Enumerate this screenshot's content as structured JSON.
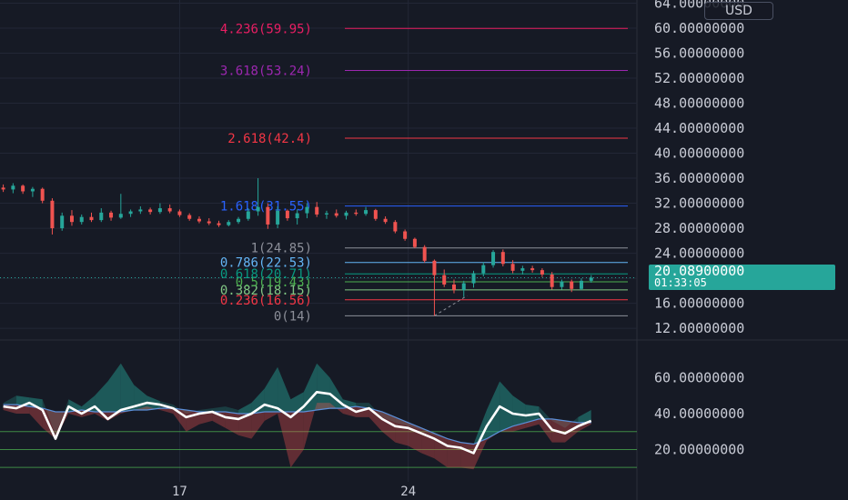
{
  "currency_label": "USD",
  "price_label": {
    "price": "20.08900000",
    "countdown": "01:33:05"
  },
  "x_axis": {
    "ticks": [
      {
        "label": "17",
        "day": 17
      },
      {
        "label": "24",
        "day": 24
      }
    ]
  },
  "colors": {
    "background": "#161a25",
    "up": "#26a69a",
    "down": "#ef5350",
    "grid": "#222736",
    "axis_text": "#c9ccd6"
  },
  "chart_data": [
    {
      "type": "candlestick",
      "y_scale": "linear",
      "ylim": [
        11,
        64.5
      ],
      "y_ticks": [
        {
          "value": 12,
          "label": "12.00000000"
        },
        {
          "value": 16,
          "label": "16.00000000"
        },
        {
          "value": 20,
          "label": "20.00000000"
        },
        {
          "value": 24,
          "label": "24.00000000"
        },
        {
          "value": 28,
          "label": "28.00000000"
        },
        {
          "value": 32,
          "label": "32.00000000"
        },
        {
          "value": 36,
          "label": "36.00000000"
        },
        {
          "value": 40,
          "label": "40.00000000"
        },
        {
          "value": 44,
          "label": "44.00000000"
        },
        {
          "value": 48,
          "label": "48.00000000"
        },
        {
          "value": 52,
          "label": "52.00000000"
        },
        {
          "value": 56,
          "label": "56.00000000"
        },
        {
          "value": 60,
          "label": "60.00000000"
        },
        {
          "value": 64,
          "label": "64.00000000"
        }
      ],
      "fib_levels": [
        {
          "ratio": "0",
          "value": 14,
          "label": "0(14)",
          "color": "#8c8f99"
        },
        {
          "ratio": "0.236",
          "value": 16.56,
          "label": "0.236(16.56)",
          "color": "#f23645"
        },
        {
          "ratio": "0.382",
          "value": 18.15,
          "label": "0.382(18.15)",
          "color": "#81c784"
        },
        {
          "ratio": "0.5",
          "value": 19.43,
          "label": "0.5(19.43)",
          "color": "#4caf50"
        },
        {
          "ratio": "0.618",
          "value": 20.71,
          "label": "0.618(20.71)",
          "color": "#089981"
        },
        {
          "ratio": "0.786",
          "value": 22.53,
          "label": "0.786(22.53)",
          "color": "#64b5f6"
        },
        {
          "ratio": "1",
          "value": 24.85,
          "label": "1(24.85)",
          "color": "#8c8f99"
        },
        {
          "ratio": "1.618",
          "value": 31.55,
          "label": "1.618(31.55)",
          "color": "#2962ff"
        },
        {
          "ratio": "2.618",
          "value": 42.4,
          "label": "2.618(42.4)",
          "color": "#f23645"
        },
        {
          "ratio": "3.618",
          "value": 53.24,
          "label": "3.618(53.24)",
          "color": "#9c27b0"
        },
        {
          "ratio": "4.236",
          "value": 59.95,
          "label": "4.236(59.95)",
          "color": "#e91e63"
        }
      ],
      "candles": [
        {
          "d": 11.6,
          "o": 34.5,
          "h": 35.0,
          "l": 33.8,
          "c": 34.2
        },
        {
          "d": 11.9,
          "o": 34.2,
          "h": 35.2,
          "l": 33.6,
          "c": 34.8
        },
        {
          "d": 12.2,
          "o": 34.8,
          "h": 35.0,
          "l": 33.5,
          "c": 33.9
        },
        {
          "d": 12.5,
          "o": 33.9,
          "h": 34.6,
          "l": 33.0,
          "c": 34.3
        },
        {
          "d": 12.8,
          "o": 34.3,
          "h": 34.5,
          "l": 32.0,
          "c": 32.4
        },
        {
          "d": 13.1,
          "o": 32.4,
          "h": 32.8,
          "l": 27.0,
          "c": 28.0
        },
        {
          "d": 13.4,
          "o": 28.0,
          "h": 30.5,
          "l": 27.6,
          "c": 30.0
        },
        {
          "d": 13.7,
          "o": 30.0,
          "h": 30.9,
          "l": 28.4,
          "c": 29.0
        },
        {
          "d": 14.0,
          "o": 29.0,
          "h": 30.2,
          "l": 28.6,
          "c": 29.8
        },
        {
          "d": 14.3,
          "o": 29.8,
          "h": 30.5,
          "l": 29.0,
          "c": 29.3
        },
        {
          "d": 14.6,
          "o": 29.3,
          "h": 31.2,
          "l": 29.0,
          "c": 30.5
        },
        {
          "d": 14.9,
          "o": 30.5,
          "h": 30.8,
          "l": 29.2,
          "c": 29.7
        },
        {
          "d": 15.2,
          "o": 29.7,
          "h": 33.5,
          "l": 29.5,
          "c": 30.3
        },
        {
          "d": 15.5,
          "o": 30.3,
          "h": 31.0,
          "l": 29.8,
          "c": 30.7
        },
        {
          "d": 15.8,
          "o": 30.7,
          "h": 31.5,
          "l": 30.3,
          "c": 31.0
        },
        {
          "d": 16.1,
          "o": 31.0,
          "h": 31.3,
          "l": 30.2,
          "c": 30.6
        },
        {
          "d": 16.4,
          "o": 30.6,
          "h": 32.0,
          "l": 30.3,
          "c": 31.2
        },
        {
          "d": 16.7,
          "o": 31.2,
          "h": 31.8,
          "l": 30.4,
          "c": 30.7
        },
        {
          "d": 17.0,
          "o": 30.7,
          "h": 31.0,
          "l": 29.8,
          "c": 30.1
        },
        {
          "d": 17.3,
          "o": 30.1,
          "h": 30.4,
          "l": 29.2,
          "c": 29.5
        },
        {
          "d": 17.6,
          "o": 29.5,
          "h": 29.9,
          "l": 28.8,
          "c": 29.1
        },
        {
          "d": 17.9,
          "o": 29.1,
          "h": 29.6,
          "l": 28.5,
          "c": 28.8
        },
        {
          "d": 18.2,
          "o": 28.8,
          "h": 29.2,
          "l": 28.2,
          "c": 28.5
        },
        {
          "d": 18.5,
          "o": 28.5,
          "h": 29.3,
          "l": 28.3,
          "c": 29.0
        },
        {
          "d": 18.8,
          "o": 29.0,
          "h": 29.8,
          "l": 28.7,
          "c": 29.5
        },
        {
          "d": 19.1,
          "o": 29.5,
          "h": 31.2,
          "l": 29.2,
          "c": 30.7
        },
        {
          "d": 19.4,
          "o": 30.7,
          "h": 36.0,
          "l": 30.0,
          "c": 31.4
        },
        {
          "d": 19.7,
          "o": 31.4,
          "h": 32.0,
          "l": 27.9,
          "c": 28.6
        },
        {
          "d": 20.0,
          "o": 28.6,
          "h": 31.5,
          "l": 28.0,
          "c": 30.8
        },
        {
          "d": 20.3,
          "o": 30.8,
          "h": 31.0,
          "l": 29.2,
          "c": 29.6
        },
        {
          "d": 20.6,
          "o": 29.6,
          "h": 31.0,
          "l": 28.6,
          "c": 30.4
        },
        {
          "d": 20.9,
          "o": 30.4,
          "h": 32.0,
          "l": 29.6,
          "c": 31.4
        },
        {
          "d": 21.2,
          "o": 31.4,
          "h": 32.2,
          "l": 29.8,
          "c": 30.2
        },
        {
          "d": 21.5,
          "o": 30.2,
          "h": 30.8,
          "l": 29.5,
          "c": 30.4
        },
        {
          "d": 21.8,
          "o": 30.4,
          "h": 31.0,
          "l": 29.7,
          "c": 30.0
        },
        {
          "d": 22.1,
          "o": 30.0,
          "h": 30.8,
          "l": 29.4,
          "c": 30.5
        },
        {
          "d": 22.4,
          "o": 30.5,
          "h": 31.0,
          "l": 30.0,
          "c": 30.3
        },
        {
          "d": 22.7,
          "o": 30.3,
          "h": 31.4,
          "l": 30.0,
          "c": 30.9
        },
        {
          "d": 23.0,
          "o": 30.9,
          "h": 31.1,
          "l": 29.2,
          "c": 29.5
        },
        {
          "d": 23.3,
          "o": 29.5,
          "h": 29.9,
          "l": 28.7,
          "c": 29.0
        },
        {
          "d": 23.6,
          "o": 29.0,
          "h": 29.3,
          "l": 27.2,
          "c": 27.5
        },
        {
          "d": 23.9,
          "o": 27.5,
          "h": 27.8,
          "l": 26.0,
          "c": 26.3
        },
        {
          "d": 24.2,
          "o": 26.3,
          "h": 26.5,
          "l": 24.8,
          "c": 25.0
        },
        {
          "d": 24.5,
          "o": 25.0,
          "h": 25.3,
          "l": 22.5,
          "c": 22.8
        },
        {
          "d": 24.8,
          "o": 22.8,
          "h": 23.0,
          "l": 14.0,
          "c": 20.5
        },
        {
          "d": 25.1,
          "o": 20.5,
          "h": 21.4,
          "l": 18.6,
          "c": 19.0
        },
        {
          "d": 25.4,
          "o": 19.0,
          "h": 19.8,
          "l": 17.6,
          "c": 18.1
        },
        {
          "d": 25.7,
          "o": 18.1,
          "h": 19.6,
          "l": 17.0,
          "c": 19.2
        },
        {
          "d": 26.0,
          "o": 19.2,
          "h": 21.2,
          "l": 18.5,
          "c": 20.8
        },
        {
          "d": 26.3,
          "o": 20.8,
          "h": 22.6,
          "l": 20.3,
          "c": 22.1
        },
        {
          "d": 26.6,
          "o": 22.1,
          "h": 24.5,
          "l": 21.7,
          "c": 24.2
        },
        {
          "d": 26.9,
          "o": 24.2,
          "h": 24.6,
          "l": 21.9,
          "c": 22.3
        },
        {
          "d": 27.2,
          "o": 22.3,
          "h": 22.9,
          "l": 20.8,
          "c": 21.2
        },
        {
          "d": 27.5,
          "o": 21.2,
          "h": 22.0,
          "l": 20.6,
          "c": 21.6
        },
        {
          "d": 27.8,
          "o": 21.6,
          "h": 22.0,
          "l": 20.9,
          "c": 21.3
        },
        {
          "d": 28.1,
          "o": 21.3,
          "h": 21.6,
          "l": 20.2,
          "c": 20.6
        },
        {
          "d": 28.4,
          "o": 20.6,
          "h": 21.0,
          "l": 18.2,
          "c": 18.6
        },
        {
          "d": 28.7,
          "o": 18.6,
          "h": 19.8,
          "l": 18.2,
          "c": 19.5
        },
        {
          "d": 29.0,
          "o": 19.5,
          "h": 19.8,
          "l": 17.8,
          "c": 18.3
        },
        {
          "d": 29.3,
          "o": 18.3,
          "h": 20.0,
          "l": 18.1,
          "c": 19.6
        },
        {
          "d": 29.6,
          "o": 19.6,
          "h": 20.5,
          "l": 19.3,
          "c": 20.1
        }
      ],
      "current_price": 20.089,
      "xlim": [
        11.5,
        31.0
      ]
    },
    {
      "type": "area",
      "name": "oscillator",
      "y_scale": "linear",
      "ylim": [
        3,
        78
      ],
      "y_ticks": [
        {
          "value": 20,
          "label": "20.00000000"
        },
        {
          "value": 40,
          "label": "40.00000000"
        },
        {
          "value": 60,
          "label": "60.00000000"
        }
      ],
      "ref_lines": [
        30,
        20,
        10
      ],
      "x": [
        11.6,
        12.0,
        12.4,
        12.8,
        13.2,
        13.6,
        14.0,
        14.4,
        14.8,
        15.2,
        15.6,
        16.0,
        16.4,
        16.8,
        17.2,
        17.6,
        18.0,
        18.4,
        18.8,
        19.2,
        19.6,
        20.0,
        20.4,
        20.8,
        21.2,
        21.6,
        22.0,
        22.4,
        22.8,
        23.2,
        23.6,
        24.0,
        24.4,
        24.8,
        25.2,
        25.6,
        26.0,
        26.4,
        26.8,
        27.2,
        27.6,
        28.0,
        28.4,
        28.8,
        29.2,
        29.6
      ],
      "fast": [
        44,
        43,
        46,
        42,
        26,
        44,
        40,
        44,
        37,
        42,
        44,
        46,
        45,
        43,
        38,
        40,
        41,
        38,
        37,
        40,
        45,
        43,
        38,
        44,
        52,
        51,
        45,
        41,
        43,
        37,
        33,
        32,
        29,
        26,
        22,
        21,
        18,
        33,
        44,
        40,
        39,
        40,
        31,
        29,
        33,
        36
      ],
      "slow": [
        45,
        45,
        44,
        43,
        41,
        41,
        42,
        41,
        41,
        41,
        42,
        42,
        43,
        43,
        42,
        41,
        41,
        41,
        40,
        40,
        41,
        41,
        41,
        41,
        42,
        43,
        43,
        44,
        43,
        41,
        38,
        35,
        32,
        29,
        26,
        24,
        23,
        26,
        30,
        33,
        35,
        37,
        37,
        36,
        35,
        35
      ],
      "spike_high": [
        46,
        50,
        49,
        48,
        28,
        48,
        44,
        50,
        58,
        68,
        56,
        50,
        47,
        45,
        40,
        42,
        43,
        44,
        42,
        46,
        54,
        66,
        48,
        52,
        68,
        60,
        48,
        46,
        46,
        38,
        35,
        33,
        31,
        28,
        26,
        24,
        23,
        42,
        58,
        50,
        45,
        44,
        36,
        32,
        38,
        42
      ],
      "spike_low": [
        42,
        40,
        40,
        32,
        26,
        40,
        38,
        40,
        36,
        40,
        42,
        44,
        42,
        40,
        30,
        34,
        36,
        32,
        28,
        26,
        36,
        40,
        10,
        20,
        46,
        46,
        40,
        38,
        38,
        30,
        24,
        22,
        18,
        15,
        10,
        10,
        9,
        25,
        30,
        30,
        32,
        34,
        24,
        24,
        30,
        34
      ]
    }
  ]
}
